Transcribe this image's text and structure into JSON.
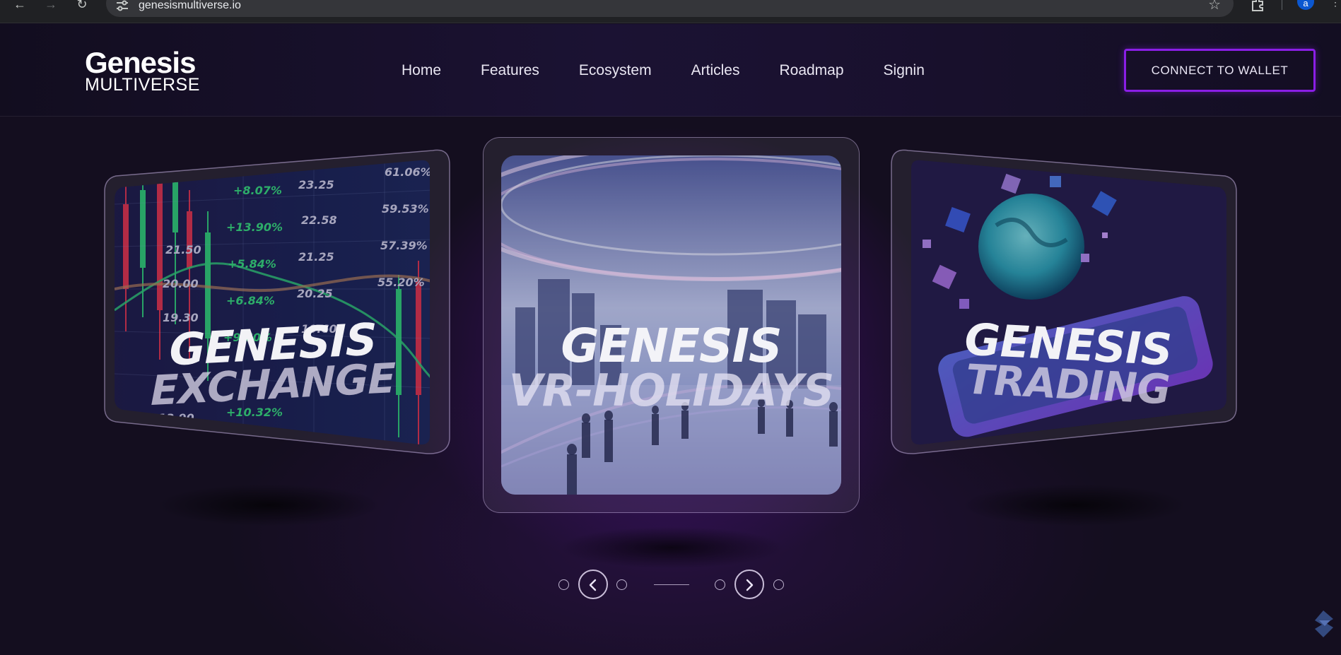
{
  "browser": {
    "url": "genesismultiverse.io",
    "profile_initial": "a"
  },
  "header": {
    "logo_title": "Genesis",
    "logo_subtitle": "MULTIVERSE",
    "nav": [
      "Home",
      "Features",
      "Ecosystem",
      "Articles",
      "Roadmap",
      "Signin"
    ],
    "connect_label": "CONNECT TO WALLET"
  },
  "carousel": {
    "cards": [
      {
        "brand": "GENESIS",
        "name": "EXCHANGE"
      },
      {
        "brand": "GENESIS",
        "name": "VR-HOLIDAYS"
      },
      {
        "brand": "GENESIS",
        "name": "TRADING"
      }
    ],
    "exchange_numbers": [
      "23.25",
      "22.58",
      "21.25",
      "20.25",
      "19.60",
      "61.06%",
      "59.53%",
      "57.39%",
      "55.20%",
      "+8.07%",
      "+13.90%",
      "+5.84%",
      "+6.84%",
      "+9.60%",
      "21.50",
      "20.00",
      "19.30",
      "13.90",
      "11.40",
      "+10.32%"
    ]
  },
  "colors": {
    "accent_purple": "#8a1ee6",
    "background": "#140e1f",
    "header_background": "#1b1233"
  }
}
